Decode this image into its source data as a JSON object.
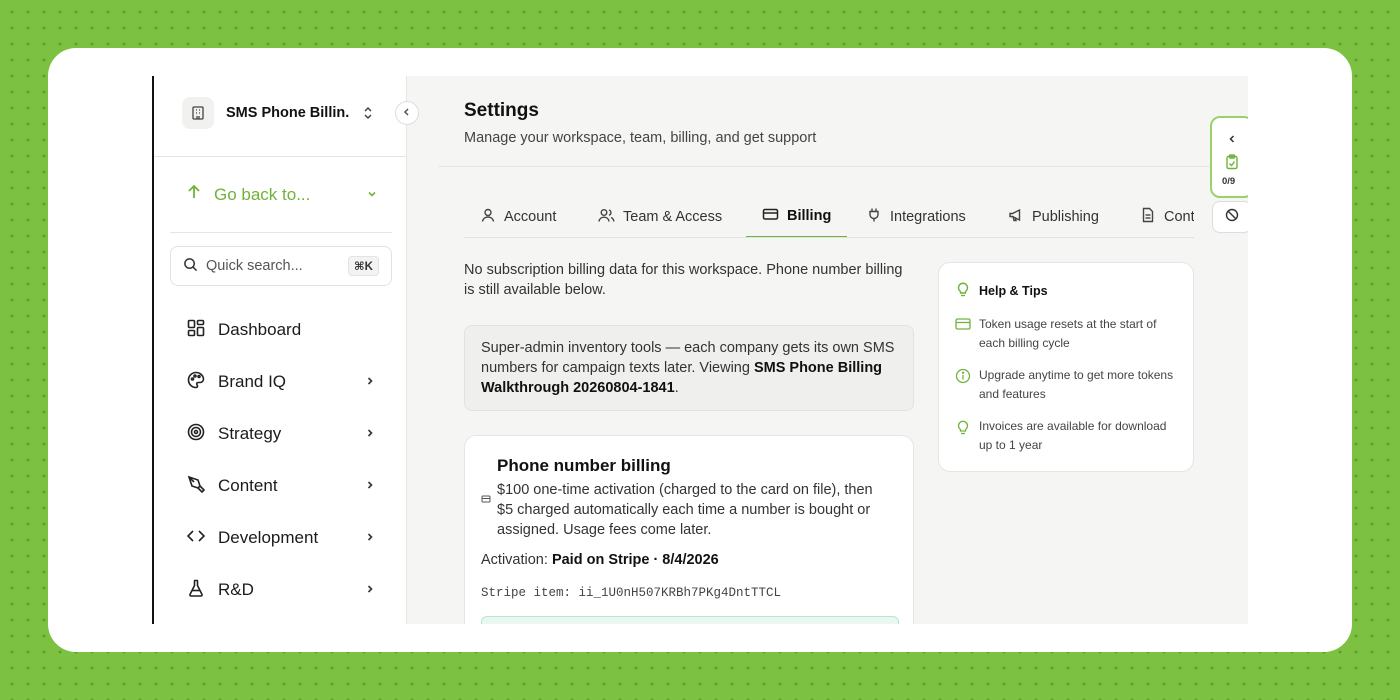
{
  "workspace": {
    "name": "SMS Phone Billin..."
  },
  "sidebar": {
    "go_back": "Go back to...",
    "search": {
      "placeholder": "Quick search...",
      "shortcut": "⌘K"
    },
    "items": [
      {
        "label": "Dashboard",
        "icon": "dashboard-icon"
      },
      {
        "label": "Brand IQ",
        "icon": "palette-icon"
      },
      {
        "label": "Strategy",
        "icon": "target-icon"
      },
      {
        "label": "Content",
        "icon": "pen-icon"
      },
      {
        "label": "Development",
        "icon": "code-icon"
      },
      {
        "label": "R&D",
        "icon": "flask-icon"
      }
    ]
  },
  "header": {
    "title": "Settings",
    "subtitle": "Manage your workspace, team, billing, and get support"
  },
  "tabs": [
    {
      "label": "Account",
      "icon": "user-icon"
    },
    {
      "label": "Team & Access",
      "icon": "users-icon"
    },
    {
      "label": "Billing",
      "icon": "credit-card-icon",
      "active": true
    },
    {
      "label": "Integrations",
      "icon": "plug-icon"
    },
    {
      "label": "Publishing",
      "icon": "megaphone-icon"
    },
    {
      "label": "Cont",
      "icon": "document-icon"
    }
  ],
  "billing": {
    "intro": "No subscription billing data for this workspace. Phone number billing is still available below.",
    "notice_prefix": "Super-admin inventory tools — each company gets its own SMS numbers for campaign texts later. Viewing ",
    "notice_bold": "SMS Phone Billing Walkthrough 20260804-1841",
    "notice_suffix": ".",
    "card": {
      "title": "Phone number billing",
      "description": "$100 one-time activation (charged to the card on file), then $5 charged automatically each time a number is bought or assigned. Usage fees come later.",
      "activation_label": "Activation:",
      "activation_value": "Paid on Stripe · 8/4/2026",
      "stripe_item": "Stripe item: ii_1U0nH507KRBh7PKg4DntTTCL"
    }
  },
  "help": {
    "title": "Help & Tips",
    "items": [
      {
        "text": "Token usage resets at the start of each billing cycle",
        "icon": "credit-card-icon"
      },
      {
        "text": "Upgrade anytime to get more tokens and features",
        "icon": "info-icon"
      },
      {
        "text": "Invoices are available for download up to 1 year",
        "icon": "lightbulb-icon"
      }
    ]
  },
  "checklist_widget": {
    "count": "0/9"
  },
  "colors": {
    "accent": "#6fb33a",
    "background": "#7cc142"
  }
}
